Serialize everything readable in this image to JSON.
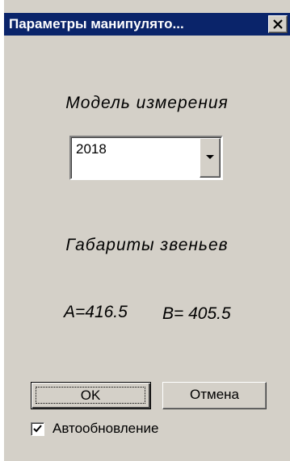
{
  "window": {
    "title": "Параметры манипулято...",
    "close_icon": "close-icon"
  },
  "model": {
    "label": "Модель измерения",
    "selected": "2018",
    "dropdown_icon": "chevron-down-icon"
  },
  "dimensions": {
    "label": "Габариты звеньев",
    "a_text": "A=416.5",
    "b_text": "B= 405.5"
  },
  "buttons": {
    "ok_label": "OK",
    "cancel_label": "Отмена"
  },
  "auto_update": {
    "label": "Автообновление",
    "checked": true
  },
  "colors": {
    "titlebar": "#0a246a",
    "face": "#d4d0c8"
  }
}
